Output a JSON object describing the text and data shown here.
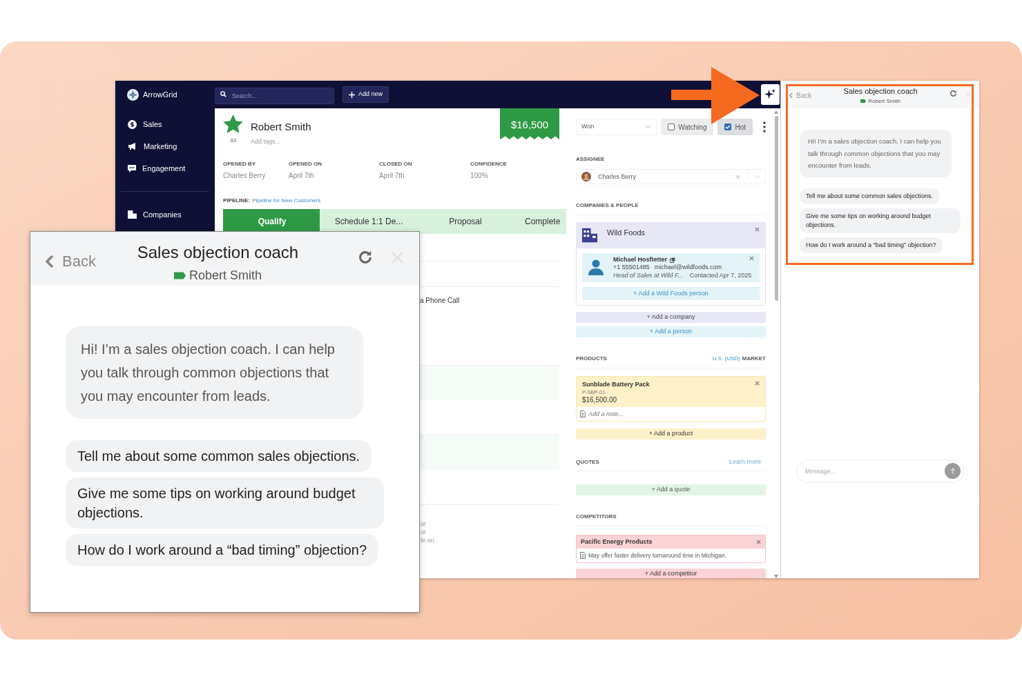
{
  "app": {
    "brand": "ArrowGrid",
    "search": {
      "placeholder": "Search..."
    },
    "add_new": "Add new",
    "nav": [
      "Sales",
      "Marketing",
      "Engagement"
    ],
    "nav_lower": [
      "Companies"
    ],
    "deal": {
      "star_count": "33",
      "name": "Robert Smith",
      "tags_placeholder": "Add tags...",
      "amount": "$16,500",
      "fields": [
        {
          "label": "OPENED BY",
          "value": "Charles Berry"
        },
        {
          "label": "OPENED ON",
          "value": "April 7th"
        },
        {
          "label": "CLOSED ON",
          "value": "April 7th"
        },
        {
          "label": "CONFIDENCE",
          "value": "100%"
        }
      ],
      "pipeline_label": "PIPELINE:",
      "pipeline_link": "Pipeline for New Customers",
      "stages": [
        {
          "label": "Qualify",
          "selected": true
        },
        {
          "label": "Schedule 1:1 De...",
          "selected": false
        },
        {
          "label": "Proposal",
          "selected": false
        },
        {
          "label": "Complete",
          "selected": false
        }
      ],
      "activity_text": "a Phone Call",
      "note_fragments": [
        "ur",
        "ur",
        "le on"
      ]
    },
    "details": {
      "status": "Won",
      "watching": {
        "label": "Watching",
        "checked": false
      },
      "hot": {
        "label": "Hot",
        "checked": true
      },
      "assignee": {
        "heading": "ASSIGNEE",
        "name": "Charles Berry"
      },
      "companies": {
        "heading": "COMPANIES & PEOPLE",
        "company": "Wild Foods",
        "person": {
          "name": "Michael Hosftetter",
          "phone": "+1 55501485",
          "email": "michael@wildfoods.com",
          "title": "Head of Sales at Wild F...",
          "contacted": "Contacted Apr 7, 2025"
        },
        "add_company_person": "+ Add a Wild Foods person",
        "add_company": "+ Add a company",
        "add_person": "+ Add a person"
      },
      "products": {
        "heading": "PRODUCTS",
        "market_link": "U.S. (USD)",
        "market_label": "MARKET",
        "items": [
          {
            "name": "Sunblade Battery Pack",
            "sku": "P-SBP-01",
            "price": "$16,500.00",
            "note_placeholder": "Add a note..."
          }
        ],
        "add": "+ Add a product"
      },
      "quotes": {
        "heading": "QUOTES",
        "learn_more": "Learn more",
        "add": "+ Add a quote"
      },
      "competitors": {
        "heading": "COMPETITORS",
        "items": [
          {
            "name": "Pacific Energy Products",
            "note": "May offer faster delivery turnaround time in Michigan."
          }
        ],
        "add": "+ Add a competitor"
      }
    }
  },
  "chat": {
    "back": "Back",
    "title": "Sales objection coach",
    "subtitle": "Robert Smith",
    "message": "Hi! I’m a sales objection coach. I can help you talk through common objections that you may encounter from leads.",
    "suggestions": [
      "Tell me about some common sales objections.",
      "Give me some tips on working around budget objections.",
      "How do I work around a “bad timing” objection?"
    ],
    "input": {
      "placeholder": "Message..."
    }
  },
  "callout": {
    "back": "Back",
    "title": "Sales objection coach",
    "subtitle": "Robert Smith",
    "message": "Hi! I’m a sales objection coach. I can help you talk through common objections that you may encounter from leads.",
    "suggestions": [
      "Tell me about some common sales objections.",
      "Give me some tips on working around budget objections.",
      "How do I work around a “bad timing” objection?"
    ]
  }
}
